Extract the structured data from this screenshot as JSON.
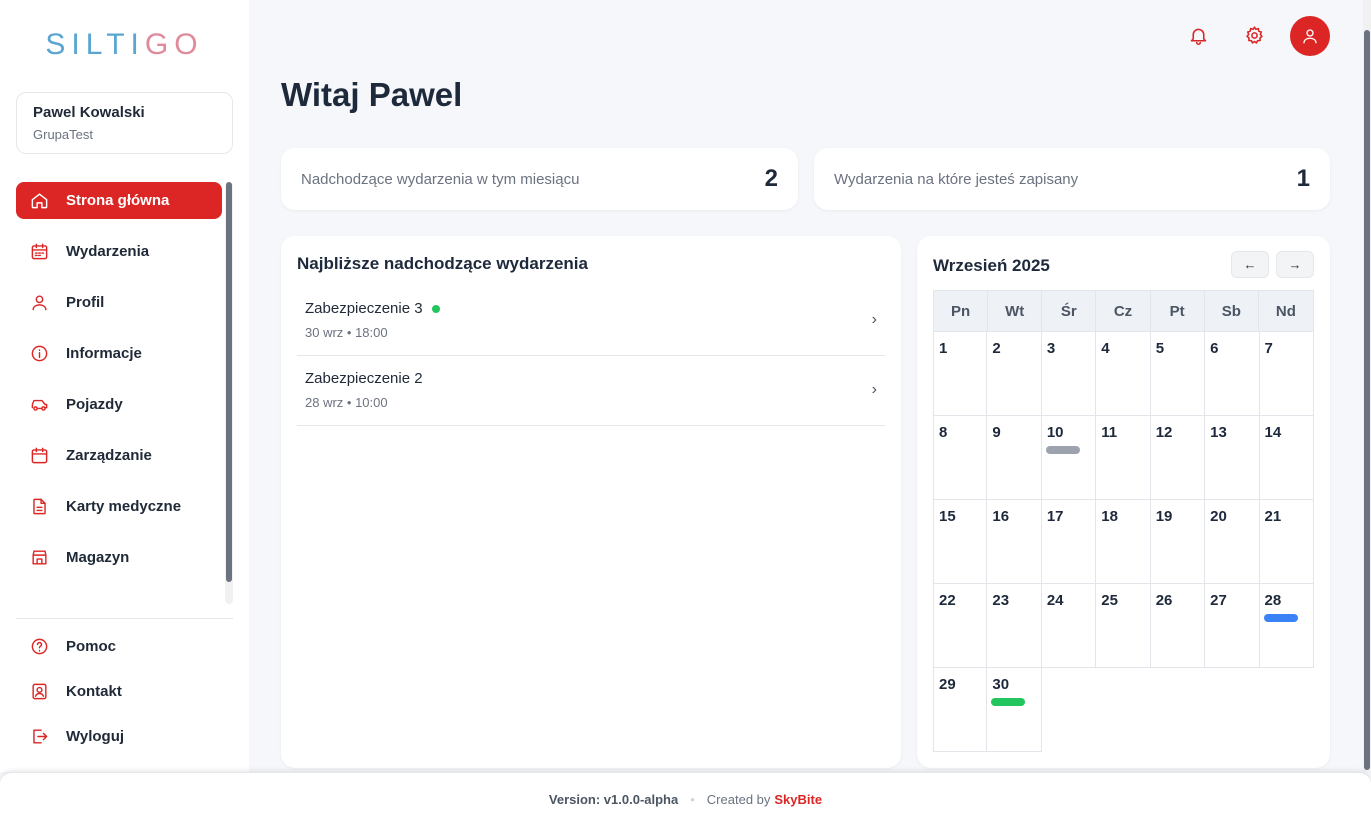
{
  "app": {
    "logo_part1": "SILTI",
    "logo_part2": "GO"
  },
  "user": {
    "name": "Pawel Kowalski",
    "group": "GrupaTest"
  },
  "nav": {
    "items": [
      {
        "label": "Strona główna",
        "icon": "home-icon",
        "active": true
      },
      {
        "label": "Wydarzenia",
        "icon": "calendar-icon"
      },
      {
        "label": "Profil",
        "icon": "user-icon"
      },
      {
        "label": "Informacje",
        "icon": "info-icon"
      },
      {
        "label": "Pojazdy",
        "icon": "car-icon"
      },
      {
        "label": "Zarządzanie",
        "icon": "calendar-manage-icon"
      },
      {
        "label": "Karty medyczne",
        "icon": "document-icon"
      },
      {
        "label": "Magazyn",
        "icon": "store-icon"
      }
    ],
    "bottom": [
      {
        "label": "Pomoc",
        "icon": "help-icon"
      },
      {
        "label": "Kontakt",
        "icon": "contact-icon"
      },
      {
        "label": "Wyloguj",
        "icon": "logout-icon"
      }
    ]
  },
  "header": {
    "bell_icon": "bell-icon",
    "settings_icon": "gear-icon",
    "avatar_icon": "user-icon"
  },
  "main": {
    "title": "Witaj Pawel",
    "stats": [
      {
        "label": "Nadchodzące wydarzenia w tym miesiącu",
        "value": "2"
      },
      {
        "label": "Wydarzenia na które jesteś zapisany",
        "value": "1"
      }
    ],
    "upcoming": {
      "title": "Najbliższe nadchodzące wydarzenia",
      "events": [
        {
          "name": "Zabezpieczenie 3",
          "date": "30 wrz • 18:00",
          "registered": true
        },
        {
          "name": "Zabezpieczenie 2",
          "date": "28 wrz • 10:00",
          "registered": false
        }
      ]
    },
    "calendar": {
      "title": "Wrzesień 2025",
      "prev_label": "←",
      "next_label": "→",
      "weekdays": [
        "Pn",
        "Wt",
        "Śr",
        "Cz",
        "Pt",
        "Sb",
        "Nd"
      ],
      "days_in_month": 30,
      "first_weekday_index": 0,
      "event_markers": [
        {
          "day": 10,
          "color": "#9ca3af"
        },
        {
          "day": 28,
          "color": "#3b82f6"
        },
        {
          "day": 30,
          "color": "#22c55e"
        }
      ]
    }
  },
  "footer": {
    "version": "Version: v1.0.0-alpha",
    "separator": "•",
    "created": "Created by",
    "brand": "SkyBite"
  },
  "colors": {
    "accent": "#dc2626",
    "background": "#f5f7fa"
  }
}
